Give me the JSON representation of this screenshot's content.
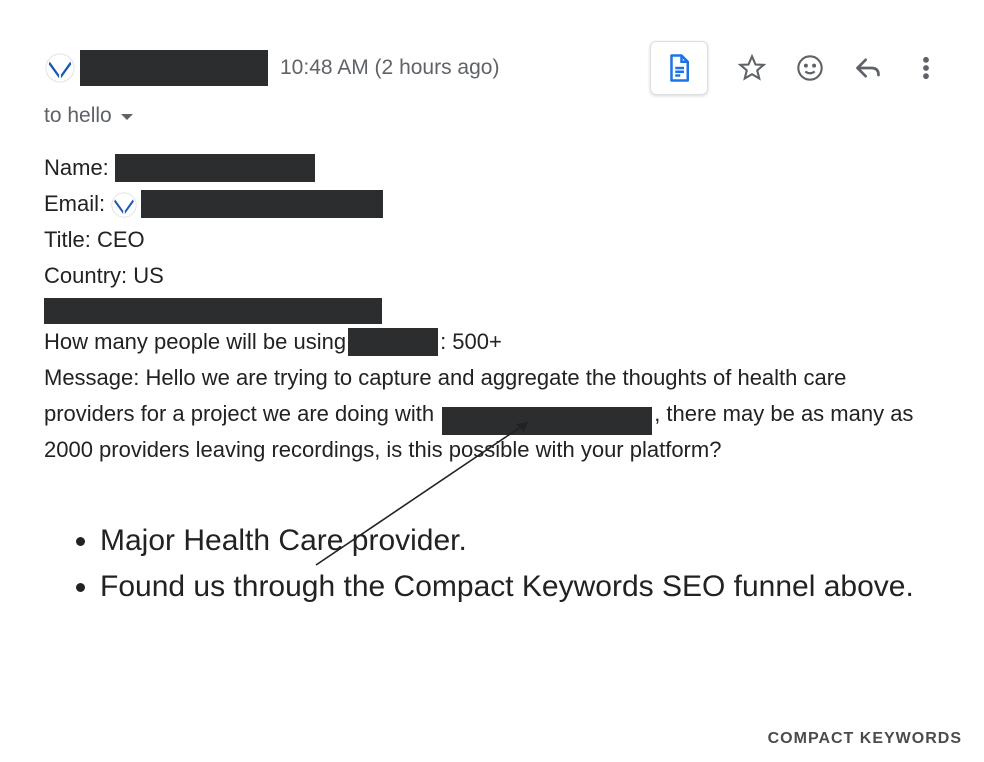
{
  "header": {
    "timestamp": "10:48 AM (2 hours ago)"
  },
  "to_line": {
    "prefix": "to",
    "recipient": "hello"
  },
  "fields": {
    "name_label": "Name:",
    "email_label": "Email:",
    "title_label": "Title:",
    "title_value": "CEO",
    "country_label": "Country:",
    "country_value": "US",
    "usage_prefix": "How many people will be using ",
    "usage_suffix": ": 500+",
    "message_label": "Message:",
    "message_part1": "Hello we are trying to capture and aggregate the thoughts of health care providers for a project we are doing with ",
    "message_part2": ", there may be as many as 2000 providers leaving recordings, is this possible with your platform?"
  },
  "annotations": [
    "Major Health Care provider.",
    "Found us through the Compact Keywords SEO funnel above."
  ],
  "watermark": "COMPACT KEYWORDS"
}
